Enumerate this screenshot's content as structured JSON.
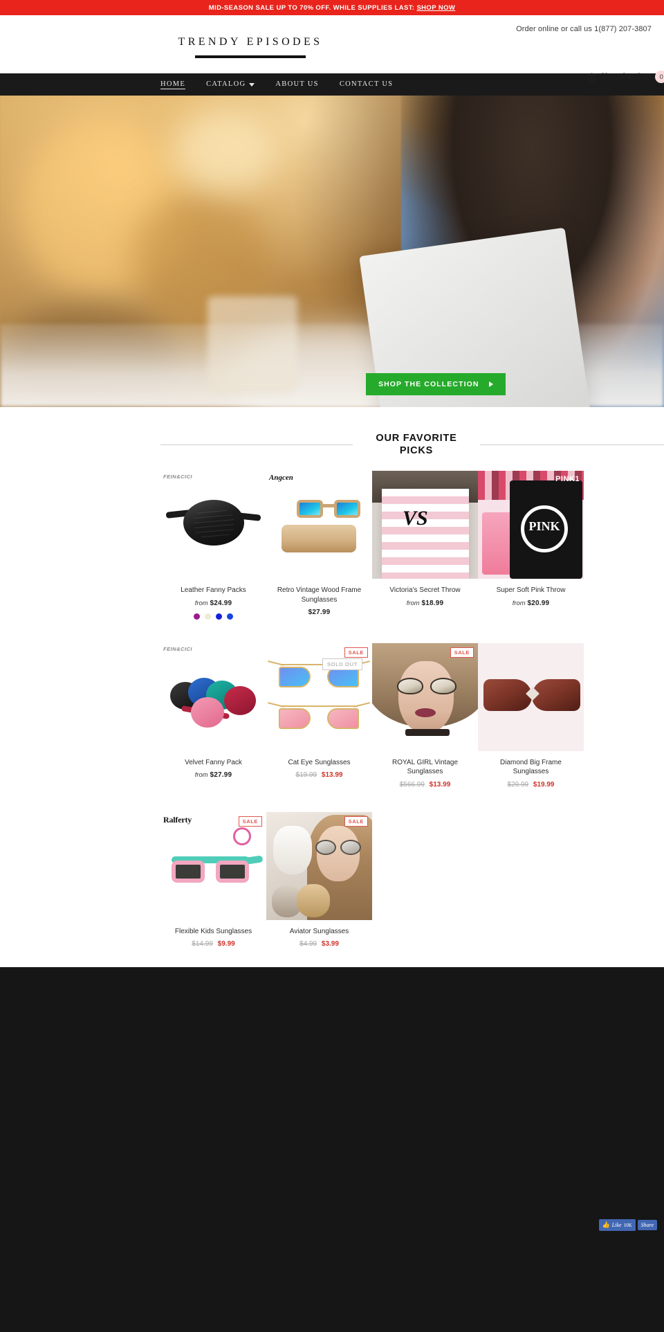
{
  "announcement": {
    "text": "MID-SEASON SALE UP TO 70% OFF. WHILE SUPPLIES LAST:",
    "link_label": "SHOP NOW",
    "bg_color": "#e8241c"
  },
  "header": {
    "phone_text": "Order online or call us 1(877) 207-3807",
    "logo": "TRENDY EPISODES",
    "cart_label": "Shopping Cart",
    "cart_count": "0",
    "wishlist_label": "M"
  },
  "nav": {
    "items": [
      {
        "label": "HOME",
        "active": true,
        "has_caret": false
      },
      {
        "label": "CATALOG",
        "active": false,
        "has_caret": true
      },
      {
        "label": "ABOUT US",
        "active": false,
        "has_caret": false
      },
      {
        "label": "CONTACT US",
        "active": false,
        "has_caret": false
      }
    ]
  },
  "hero": {
    "cta_label": "SHOP THE COLLECTION",
    "cta_color": "#26aa2b"
  },
  "section": {
    "title": "OUR FAVORITE PICKS"
  },
  "products": [
    {
      "brand": "FEIN&CICI",
      "title": "Leather Fanny Packs",
      "price_prefix": "from",
      "price": "$24.99",
      "old_price": "",
      "sale_price": "",
      "badge": "",
      "swatches": [
        "#9c1a8f",
        "#f0ead2",
        "#1520d8",
        "#1546e0"
      ]
    },
    {
      "brand": "Angcen",
      "title": "Retro Vintage Wood Frame Sunglasses",
      "price_prefix": "",
      "price": "$27.99",
      "old_price": "",
      "sale_price": "",
      "badge": "",
      "swatches": []
    },
    {
      "brand": "",
      "title": "Victoria's Secret Throw",
      "price_prefix": "from",
      "price": "$18.99",
      "old_price": "",
      "sale_price": "",
      "badge": "",
      "swatches": []
    },
    {
      "brand": "",
      "title": "Super Soft Pink Throw",
      "price_prefix": "from",
      "price": "$20.99",
      "old_price": "",
      "sale_price": "",
      "badge": "",
      "swatches": [],
      "overlay_label": "PINK1"
    },
    {
      "brand": "FEIN&CICI",
      "title": "Velvet Fanny Pack",
      "price_prefix": "from",
      "price": "$27.99",
      "old_price": "",
      "sale_price": "",
      "badge": "",
      "swatches": []
    },
    {
      "brand": "",
      "title": "Cat Eye Sunglasses",
      "price_prefix": "",
      "price": "",
      "old_price": "$19.99",
      "sale_price": "$13.99",
      "badge": "SALE",
      "badge2": "SOLD OUT",
      "swatches": []
    },
    {
      "brand": "",
      "title": "ROYAL GIRL Vintage Sunglasses",
      "price_prefix": "",
      "price": "",
      "old_price": "$566.99",
      "sale_price": "$13.99",
      "badge": "SALE",
      "swatches": []
    },
    {
      "brand": "",
      "title": "Diamond Big Frame Sunglasses",
      "price_prefix": "",
      "price": "",
      "old_price": "$29.99",
      "sale_price": "$19.99",
      "badge": "",
      "swatches": []
    },
    {
      "brand": "Ralferty",
      "title": "Flexible Kids Sunglasses",
      "price_prefix": "",
      "price": "",
      "old_price": "$14.99",
      "sale_price": "$9.99",
      "badge": "SALE",
      "swatches": []
    },
    {
      "brand": "",
      "title": "Aviator Sunglasses",
      "price_prefix": "",
      "price": "",
      "old_price": "$4.99",
      "sale_price": "$3.99",
      "badge": "SALE",
      "swatches": []
    }
  ],
  "footer": {
    "fb_like_label": "Like",
    "fb_like_count": "10K",
    "fb_share_label": "Share"
  }
}
